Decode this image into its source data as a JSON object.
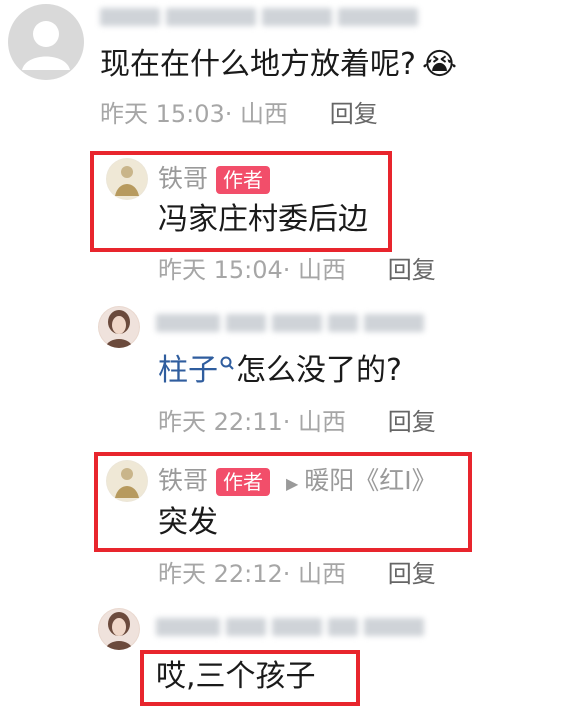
{
  "colors": {
    "accent": "#e8252d",
    "badge": "#f24e6a",
    "link": "#2f5d9e"
  },
  "top_comment": {
    "text": "现在在什么地方放着呢?",
    "emoji": "😭",
    "time": "昨天 15:03",
    "location": "· 山西",
    "reply": "回复"
  },
  "replies": [
    {
      "name": "铁哥",
      "badge": "作者",
      "text": "冯家庄村委后边",
      "time": "昨天 15:04",
      "location": "· 山西",
      "reply": "回复"
    },
    {
      "mention": "柱子",
      "text_after": "怎么没了的?",
      "time": "昨天 22:11",
      "location": "· 山西",
      "reply": "回复"
    },
    {
      "name": "铁哥",
      "badge": "作者",
      "reply_to": "暖阳《红I》",
      "text": "突发",
      "time": "昨天 22:12",
      "location": "· 山西",
      "reply": "回复"
    },
    {
      "text": "哎,三个孩子"
    }
  ]
}
